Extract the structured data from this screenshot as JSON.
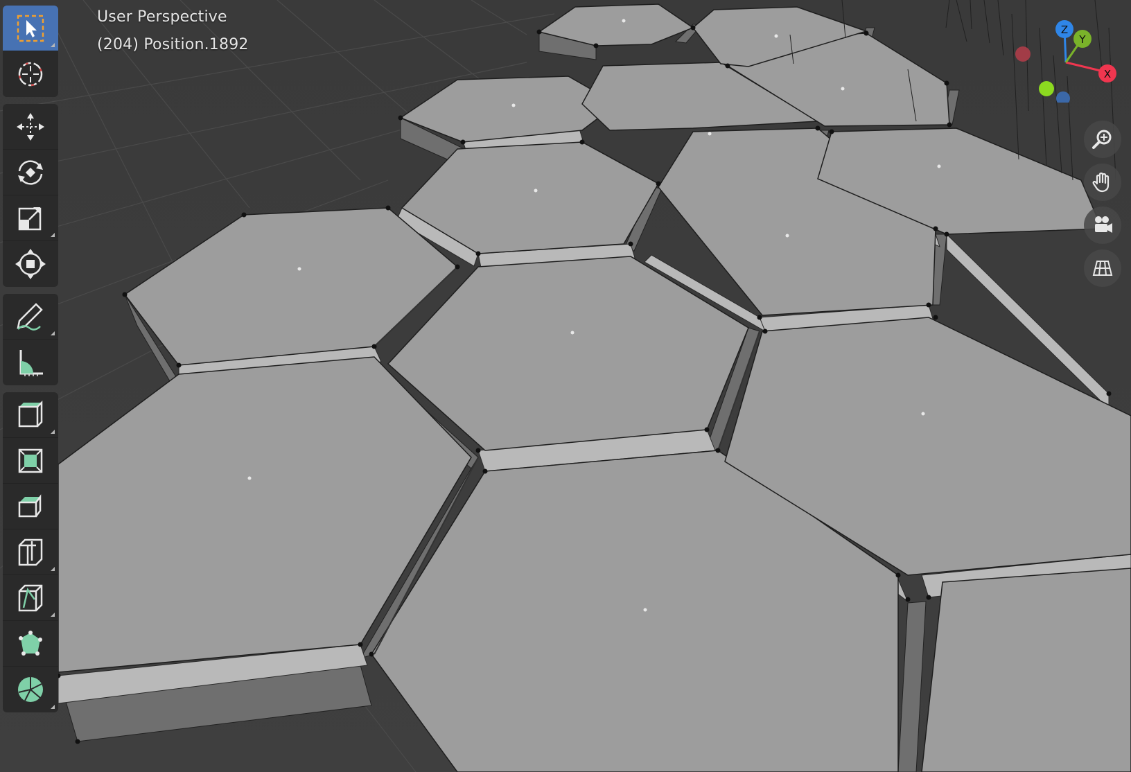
{
  "viewport": {
    "mode_label": "User Perspective",
    "object_label": "(204) Position.1892"
  },
  "gizmo": {
    "z_label": "Z",
    "y_label": "Y",
    "x_label": "X",
    "colors": {
      "x": "#f0364f",
      "y": "#7ab32a",
      "z": "#2f86e8",
      "neg_x": "#a23c47",
      "neg_y": "#8cd920",
      "neg_z": "#3b68a8"
    }
  },
  "toolbar": {
    "tools": [
      {
        "name": "select-box-tool",
        "icon": "select-box-icon",
        "active": true
      },
      {
        "name": "cursor-tool",
        "icon": "cursor-icon"
      },
      {
        "name": "move-tool",
        "icon": "move-icon"
      },
      {
        "name": "rotate-tool",
        "icon": "rotate-icon"
      },
      {
        "name": "scale-tool",
        "icon": "scale-icon"
      },
      {
        "name": "transform-tool",
        "icon": "transform-icon"
      },
      {
        "name": "annotate-tool",
        "icon": "annotate-icon"
      },
      {
        "name": "measure-tool",
        "icon": "measure-icon"
      },
      {
        "name": "add-cube-tool",
        "icon": "add-cube-icon"
      },
      {
        "name": "extrude-region-tool",
        "icon": "extrude-icon"
      },
      {
        "name": "inset-faces-tool",
        "icon": "inset-icon"
      },
      {
        "name": "bevel-tool",
        "icon": "bevel-icon"
      },
      {
        "name": "loop-cut-tool",
        "icon": "loop-cut-icon"
      },
      {
        "name": "knife-tool",
        "icon": "knife-icon"
      },
      {
        "name": "poly-build-tool",
        "icon": "poly-build-icon"
      },
      {
        "name": "spin-tool",
        "icon": "spin-icon"
      }
    ]
  },
  "navigation": [
    {
      "name": "zoom-button",
      "icon": "zoom-icon"
    },
    {
      "name": "pan-button",
      "icon": "hand-icon"
    },
    {
      "name": "camera-view-button",
      "icon": "camera-icon"
    },
    {
      "name": "ortho-toggle-button",
      "icon": "grid-icon"
    }
  ]
}
